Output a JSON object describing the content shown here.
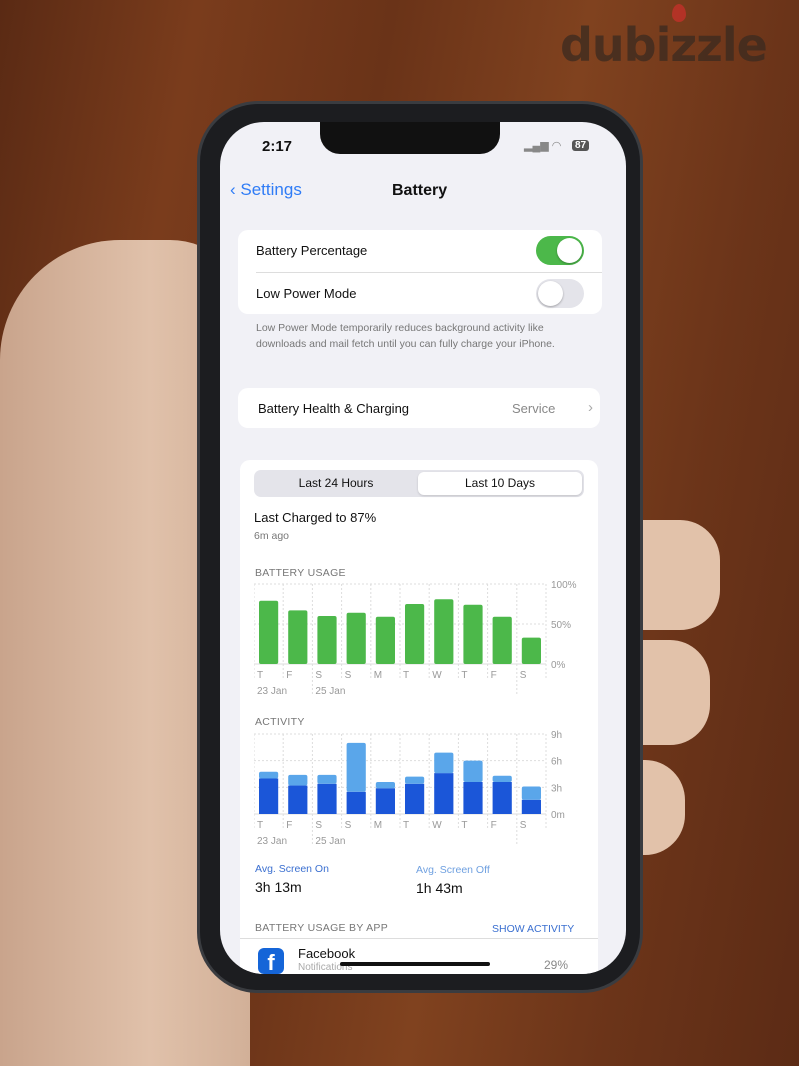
{
  "watermark": "dubizzle",
  "status": {
    "time": "2:17",
    "battery": "87"
  },
  "nav": {
    "back": "Settings",
    "title": "Battery"
  },
  "settings": {
    "battery_percentage": {
      "label": "Battery Percentage",
      "on": true
    },
    "low_power": {
      "label": "Low Power Mode",
      "on": false
    },
    "footnote": "Low Power Mode temporarily reduces background activity like downloads and mail fetch until you can fully charge your iPhone.",
    "health": {
      "label": "Battery Health & Charging",
      "value": "Service"
    }
  },
  "tabs": [
    {
      "label": "Last 24 Hours",
      "selected": false
    },
    {
      "label": "Last 10 Days",
      "selected": true
    }
  ],
  "last_charged": {
    "title": "Last Charged to 87%",
    "subtitle": "6m ago"
  },
  "chart_data": [
    {
      "type": "bar",
      "title": "BATTERY USAGE",
      "categories": [
        "T",
        "F",
        "S",
        "S",
        "M",
        "T",
        "W",
        "T",
        "F",
        "S"
      ],
      "date_labels": [
        "23 Jan",
        "25 Jan"
      ],
      "yticks": [
        "100%",
        "50%",
        "0%"
      ],
      "ylim": [
        0,
        100
      ],
      "values": [
        79,
        67,
        60,
        64,
        59,
        75,
        81,
        74,
        59,
        33
      ],
      "color": "#4cb84a"
    },
    {
      "type": "bar",
      "title": "ACTIVITY",
      "categories": [
        "T",
        "F",
        "S",
        "S",
        "M",
        "T",
        "W",
        "T",
        "F",
        "S"
      ],
      "date_labels": [
        "23 Jan",
        "25 Jan"
      ],
      "yticks": [
        "9h",
        "6h",
        "3h",
        "0m"
      ],
      "ylim": [
        0,
        9
      ],
      "stacked": true,
      "series": [
        {
          "values": [
            4.0,
            3.2,
            3.4,
            2.5,
            2.9,
            3.4,
            4.6,
            3.6,
            3.6,
            1.6
          ],
          "color": "#1b56d8"
        },
        {
          "values": [
            0.75,
            1.2,
            1.0,
            5.5,
            0.7,
            0.8,
            2.3,
            2.4,
            0.7,
            1.5
          ],
          "color": "#5aa6ea"
        }
      ]
    }
  ],
  "averages": {
    "on_label": "Avg. Screen On",
    "on_value": "3h 13m",
    "off_label": "Avg. Screen Off",
    "off_value": "1h 43m"
  },
  "by_app": {
    "header": "BATTERY USAGE BY APP",
    "action": "SHOW ACTIVITY",
    "apps": [
      {
        "name": "Facebook",
        "sub": "Notifications",
        "pct": "29%"
      }
    ]
  }
}
